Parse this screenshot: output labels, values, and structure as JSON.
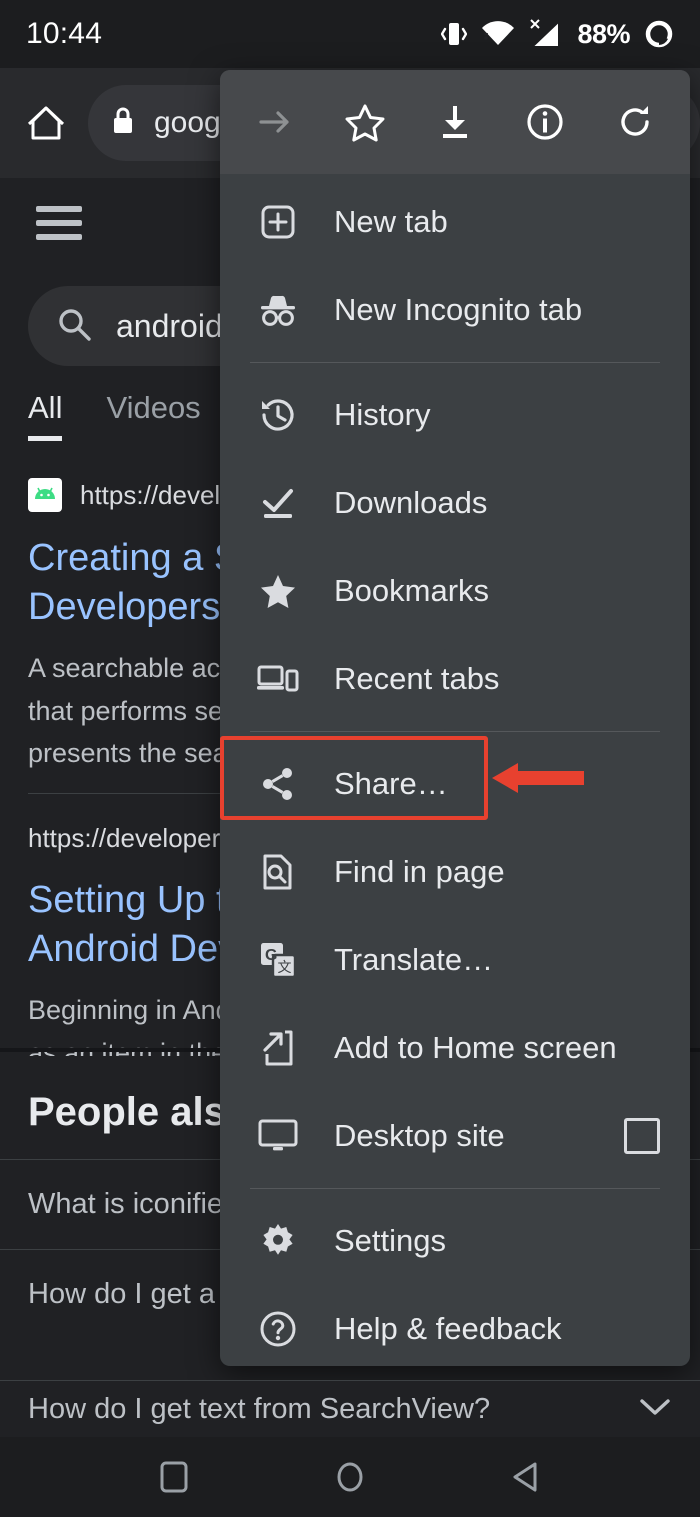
{
  "status_bar": {
    "time": "10:44",
    "battery_percent": "88%",
    "icons": [
      "vibrate-icon",
      "wifi-icon",
      "cellular-signal-off-icon",
      "battery-icon"
    ]
  },
  "browser": {
    "home_icon": "home-icon",
    "lock_icon": "lock-icon",
    "omnibox_text": "goog"
  },
  "search_page": {
    "menu_icon": "hamburger-icon",
    "search_icon": "search-icon",
    "search_query": "android",
    "tabs": [
      {
        "label": "All",
        "active": true
      },
      {
        "label": "Videos",
        "active": false
      }
    ],
    "results": [
      {
        "favicon": "android-icon",
        "url": "https://develop",
        "title_lines": [
          "Creating a S",
          "Developers"
        ],
        "snippet_lines": [
          "A searchable act",
          "that performs se",
          "presents the sea"
        ]
      },
      {
        "favicon": "",
        "url": "https://developer.ar",
        "title_lines": [
          "Setting Up t",
          "Android Dev"
        ],
        "snippet_lines": [
          "Beginning in And",
          "as an item in the"
        ]
      }
    ],
    "people_also_ask": {
      "title": "People also",
      "items": [
        {
          "question": "What is iconified",
          "chevron": ""
        },
        {
          "question": "How do I get a se",
          "chevron": ""
        }
      ]
    },
    "bottom_question": {
      "question": "How do I get text from SearchView?",
      "chevron": "chevron-down-icon"
    }
  },
  "menu": {
    "top_actions": [
      {
        "name": "forward-arrow-icon",
        "label": "Forward",
        "disabled": true
      },
      {
        "name": "star-icon",
        "label": "Bookmark",
        "disabled": false
      },
      {
        "name": "download-icon",
        "label": "Download",
        "disabled": false
      },
      {
        "name": "page-info-icon",
        "label": "Page info",
        "disabled": false
      },
      {
        "name": "reload-icon",
        "label": "Reload",
        "disabled": false
      }
    ],
    "items": [
      {
        "icon": "new-tab-icon",
        "label": "New tab",
        "divider_after": false,
        "trailing": ""
      },
      {
        "icon": "incognito-icon",
        "label": "New Incognito tab",
        "divider_after": true,
        "trailing": ""
      },
      {
        "icon": "history-icon",
        "label": "History",
        "divider_after": false,
        "trailing": ""
      },
      {
        "icon": "downloads-icon",
        "label": "Downloads",
        "divider_after": false,
        "trailing": ""
      },
      {
        "icon": "bookmarks-icon",
        "label": "Bookmarks",
        "divider_after": false,
        "trailing": ""
      },
      {
        "icon": "recent-tabs-icon",
        "label": "Recent tabs",
        "divider_after": true,
        "trailing": ""
      },
      {
        "icon": "share-icon",
        "label": "Share…",
        "divider_after": false,
        "trailing": "",
        "highlighted": true
      },
      {
        "icon": "find-in-page-icon",
        "label": "Find in page",
        "divider_after": false,
        "trailing": ""
      },
      {
        "icon": "translate-icon",
        "label": "Translate…",
        "divider_after": false,
        "trailing": ""
      },
      {
        "icon": "add-to-home-screen-icon",
        "label": "Add to Home screen",
        "divider_after": false,
        "trailing": ""
      },
      {
        "icon": "desktop-site-icon",
        "label": "Desktop site",
        "divider_after": true,
        "trailing": "checkbox-unchecked"
      },
      {
        "icon": "settings-gear-icon",
        "label": "Settings",
        "divider_after": false,
        "trailing": ""
      },
      {
        "icon": "help-feedback-icon",
        "label": "Help & feedback",
        "divider_after": false,
        "trailing": ""
      }
    ]
  },
  "annotation": {
    "highlight_color": "#e8412f",
    "target_label": "Share…"
  },
  "nav_bar": {
    "buttons": [
      "recents-square-icon",
      "home-circle-icon",
      "back-triangle-icon"
    ]
  },
  "colors": {
    "menu_background": "#3c4043",
    "menu_header": "#47494c",
    "page_background": "#202124",
    "link_blue": "#99c3ff",
    "accent_red": "#e8412f"
  }
}
